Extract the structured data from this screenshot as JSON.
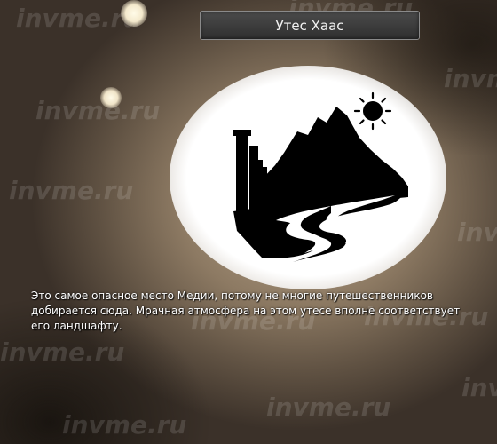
{
  "location": {
    "title": "Утес Хаас",
    "description": "Это самое опасное место Медии, потому не многие путешественников добирается сюда. Мрачная атмосфера на этом утесе вполне соответствует его ландшафту."
  },
  "watermark": {
    "text": "invme.ru"
  },
  "colors": {
    "title_bar": "#3a3a3a",
    "title_text": "#f2f2f2",
    "description_text": "#ffffff",
    "icon_fill": "#000000",
    "glow": "#ffffff"
  },
  "icons": {
    "location_icon": "cliff-with-sun-and-river-icon"
  }
}
